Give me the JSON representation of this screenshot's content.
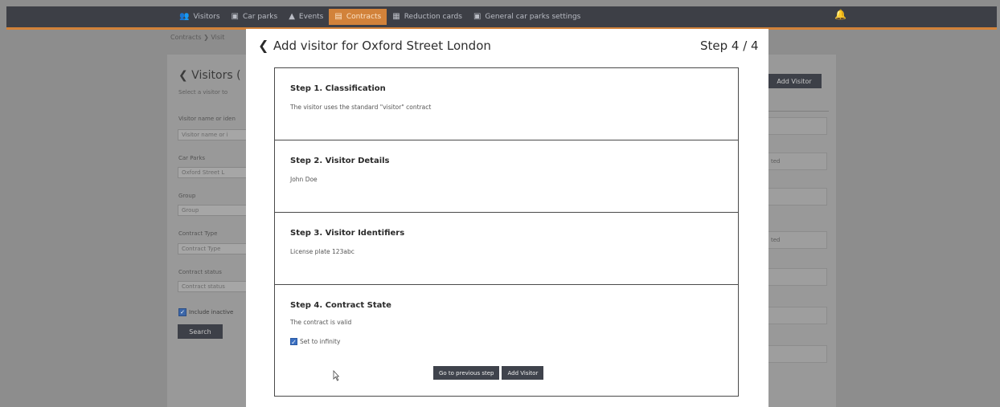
{
  "nav": {
    "items": [
      {
        "label": "Visitors",
        "icon": "visitors-icon",
        "glyph": "👥",
        "active": false
      },
      {
        "label": "Car parks",
        "icon": "car-parks-icon",
        "glyph": "▣",
        "active": false
      },
      {
        "label": "Events",
        "icon": "events-icon",
        "glyph": "▲",
        "active": false
      },
      {
        "label": "Contracts",
        "icon": "contracts-icon",
        "glyph": "▤",
        "active": true
      },
      {
        "label": "Reduction cards",
        "icon": "reduction-cards-icon",
        "glyph": "▦",
        "active": false
      },
      {
        "label": "General car parks settings",
        "icon": "settings-icon",
        "glyph": "▣",
        "active": false
      }
    ],
    "notification_icon": "bell-icon",
    "accent_color": "#d2823a",
    "bar_color": "#3d3f46"
  },
  "background": {
    "breadcrumb": "Contracts ❯ Visit",
    "title": "❮  Visitors (",
    "subtitle": "Select a visitor to",
    "filters": [
      {
        "label": "Visitor name or iden",
        "value": "Visitor name or i"
      },
      {
        "label": "Car Parks",
        "value": "Oxford Street L"
      },
      {
        "label": "Group",
        "value": "Group"
      },
      {
        "label": "Contract Type",
        "value": "Contract Type"
      },
      {
        "label": "Contract status",
        "value": "Contract status"
      }
    ],
    "include_inactive_label": "Include inactive",
    "search_label": "Search",
    "add_visitor_label": "Add Visitor",
    "table_cells": [
      "",
      "ted",
      "",
      "ted",
      "",
      "",
      ""
    ]
  },
  "modal": {
    "back_icon": "chevron-left-icon",
    "title": "Add visitor for Oxford Street London",
    "step_indicator": "Step 4 / 4",
    "steps": [
      {
        "title": "Step 1. Classification",
        "text": "The visitor uses the standard \"visitor\" contract"
      },
      {
        "title": "Step 2. Visitor Details",
        "text": "John Doe"
      },
      {
        "title": "Step 3. Visitor Identifiers",
        "text": "License plate 123abc"
      },
      {
        "title": "Step 4. Contract State",
        "text": "The contract is valid"
      }
    ],
    "infinity_checkbox": {
      "label": "Set to infinity",
      "checked": true
    },
    "previous_button": "Go to previous step",
    "add_button": "Add Visitor"
  }
}
